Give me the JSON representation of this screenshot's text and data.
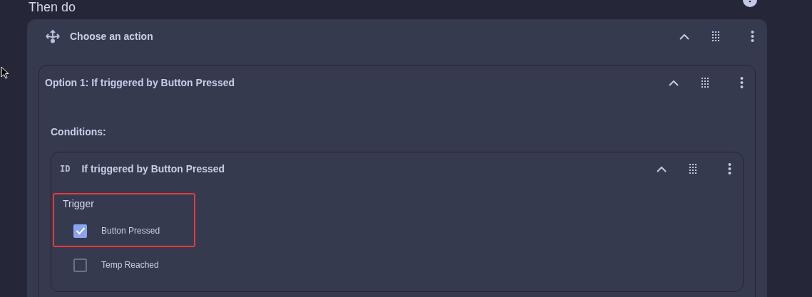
{
  "section": {
    "title": "Then do"
  },
  "action": {
    "title": "Choose an action",
    "expanded": true,
    "option": {
      "title": "Option 1: If triggered by Button Pressed",
      "expanded": true,
      "conditions_label": "Conditions:",
      "condition": {
        "badge": "ID",
        "title": "If triggered by Button Pressed",
        "expanded": true,
        "field_label": "Trigger",
        "choices": [
          {
            "label": "Button Pressed",
            "checked": true,
            "highlighted": true
          },
          {
            "label": "Temp Reached",
            "checked": false,
            "highlighted": false
          }
        ]
      }
    }
  }
}
